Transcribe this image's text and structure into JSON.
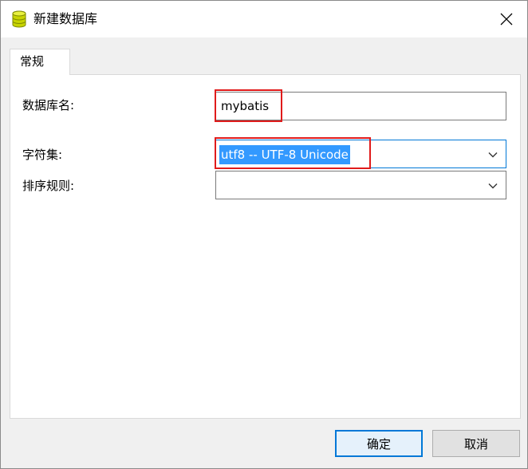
{
  "window": {
    "title": "新建数据库",
    "icon": "database-icon",
    "close_icon": "close-icon"
  },
  "tabs": [
    {
      "label": "常规",
      "active": true
    }
  ],
  "form": {
    "database_name": {
      "label": "数据库名:",
      "value": "mybatis"
    },
    "charset": {
      "label": "字符集:",
      "value": "utf8 -- UTF-8 Unicode"
    },
    "collation": {
      "label": "排序规则:",
      "value": ""
    }
  },
  "buttons": {
    "ok": "确定",
    "cancel": "取消"
  },
  "colors": {
    "accent": "#0078d7",
    "selection": "#3399ff",
    "highlight_border": "#e01b1b",
    "db_icon": "#c8d400"
  }
}
